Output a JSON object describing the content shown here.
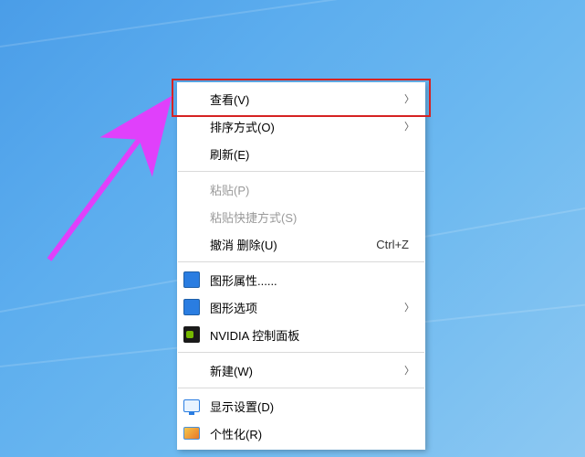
{
  "menu": {
    "view": {
      "label": "查看(V)",
      "has_submenu": true
    },
    "sort": {
      "label": "排序方式(O)",
      "has_submenu": true
    },
    "refresh": {
      "label": "刷新(E)"
    },
    "paste": {
      "label": "粘贴(P)",
      "disabled": true
    },
    "paste_shortcut": {
      "label": "粘贴快捷方式(S)",
      "disabled": true
    },
    "undo": {
      "label": "撤消 删除(U)",
      "shortcut": "Ctrl+Z"
    },
    "gfx_props": {
      "label": "图形属性......"
    },
    "gfx_options": {
      "label": "图形选项",
      "has_submenu": true
    },
    "nvidia": {
      "label": "NVIDIA 控制面板"
    },
    "new": {
      "label": "新建(W)",
      "has_submenu": true
    },
    "display_settings": {
      "label": "显示设置(D)"
    },
    "personalize": {
      "label": "个性化(R)"
    }
  }
}
